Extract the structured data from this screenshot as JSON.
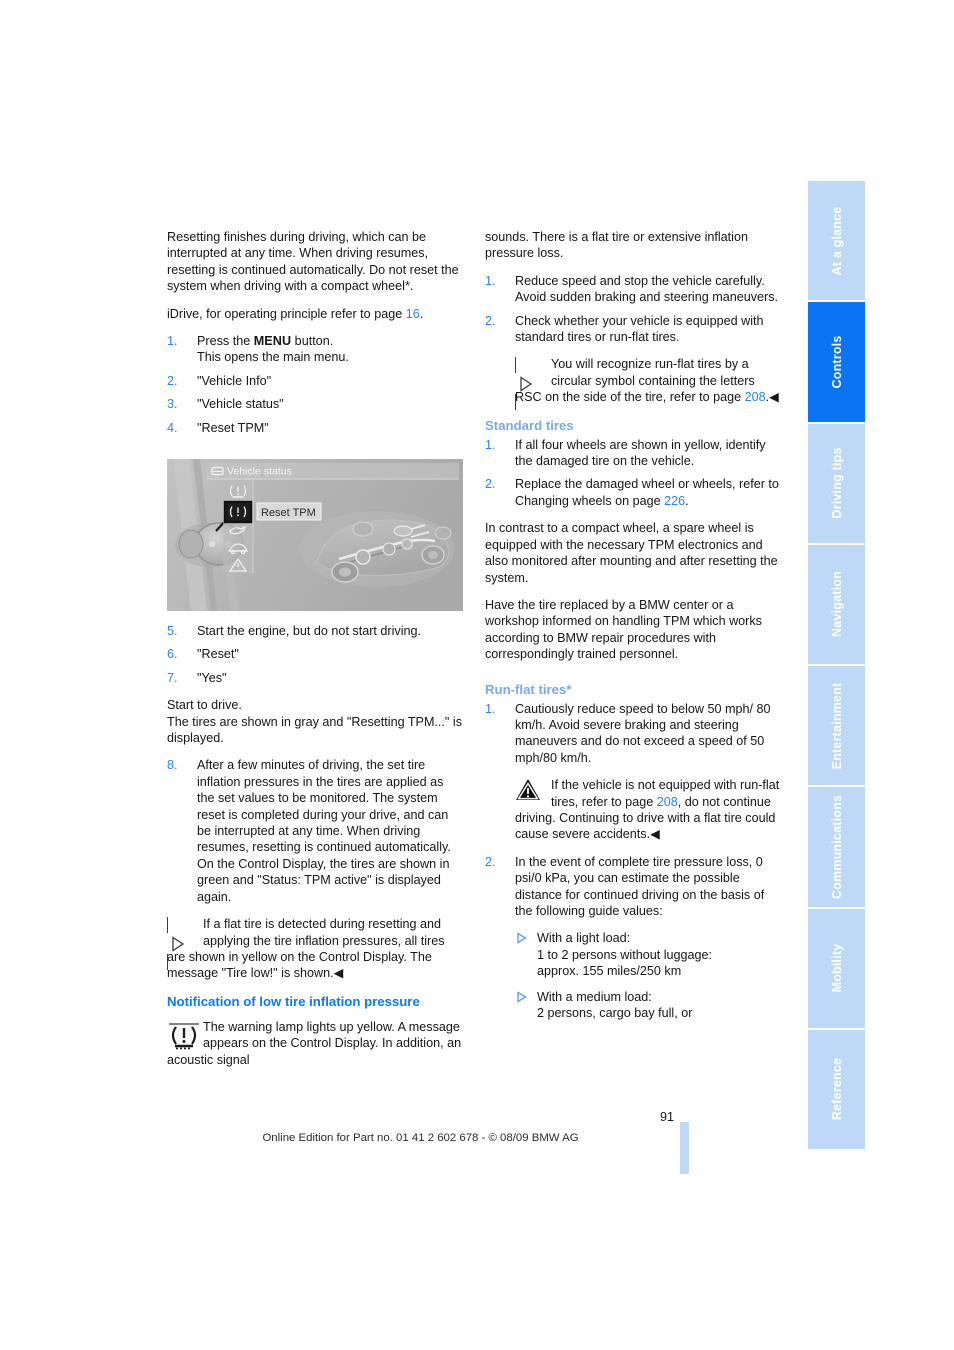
{
  "page": {
    "number": "91",
    "footer_note": "Online Edition for Part no. 01 41 2 602 678 - © 08/09 BMW AG"
  },
  "tabs": [
    {
      "label": "At a glance",
      "active": false
    },
    {
      "label": "Controls",
      "active": true
    },
    {
      "label": "Driving tips",
      "active": false
    },
    {
      "label": "Navigation",
      "active": false
    },
    {
      "label": "Entertainment",
      "active": false
    },
    {
      "label": "Communications",
      "active": false
    },
    {
      "label": "Mobility",
      "active": false
    },
    {
      "label": "Reference",
      "active": false
    }
  ],
  "colors": {
    "tab_active": "#0a74f5",
    "tab_inactive": "#bdd9f7",
    "heading_blue": "#0d7bf0",
    "subheading_blue": "#7ba9e9",
    "link_blue": "#2b83f2"
  },
  "left_column": {
    "intro_paragraph": "Resetting finishes during driving, which can be interrupted at any time. When driving resumes, resetting is continued automatically. Do not reset the system when driving with a compact wheel*.",
    "idrive_line_pre": "iDrive, for operating principle refer to page ",
    "idrive_page_ref": "16",
    "idrive_line_post": ".",
    "steps_1_4": [
      {
        "num": "1.",
        "text_pre": "Press the ",
        "bold": "MENU",
        "text_post": " button.",
        "second_line": "This opens the main menu."
      },
      {
        "num": "2.",
        "text": "\"Vehicle Info\""
      },
      {
        "num": "3.",
        "text": "\"Vehicle status\""
      },
      {
        "num": "4.",
        "text": "\"Reset TPM\""
      }
    ],
    "figure": {
      "name": "idrive-vehicle-status-screen",
      "header_label": "Vehicle status",
      "menu_item_label": "Reset TPM",
      "side_icons": [
        "tpm-status-icon",
        "reset-tpm-icon",
        "oil-can-icon",
        "car-icon",
        "warning-triangle-icon"
      ]
    },
    "steps_5_8": [
      {
        "num": "5.",
        "text": "Start the engine, but do not start driving."
      },
      {
        "num": "6.",
        "text": "\"Reset\""
      },
      {
        "num": "7.",
        "text": "\"Yes\""
      }
    ],
    "start_to_drive": "Start to drive.\nThe tires are shown in gray and \"Resetting TPM...\" is displayed.",
    "start_to_drive_line1": "Start to drive.",
    "start_to_drive_line2": "The tires are shown in gray and \"Resetting TPM...\" is displayed.",
    "step_8": {
      "num": "8.",
      "text": "After a few minutes of driving, the set tire inflation pressures in the tires are applied as the set values to be monitored. The system reset is completed during your drive, and can be interrupted at any time. When driving resumes, resetting is continued automatically. On the Control Display, the tires are shown in green and \"Status: TPM active\" is displayed again."
    },
    "note_flat_tire": "If a flat tire is detected during resetting and applying the tire inflation pressures, all tires are shown in yellow on the Control Display. The message \"Tire low!\" is shown.",
    "heading_notification": "Notification of low tire inflation pressure",
    "warning_lamp_text": "The warning lamp lights up yellow. A message appears on the Control Display. In addition, an acoustic signal"
  },
  "right_column": {
    "continuation": "sounds. There is a flat tire or extensive inflation pressure loss.",
    "steps_top": [
      {
        "num": "1.",
        "text": "Reduce speed and stop the vehicle carefully. Avoid sudden braking and steering maneuvers."
      },
      {
        "num": "2.",
        "text": "Check whether your vehicle is equipped with standard tires or run-flat tires."
      }
    ],
    "note_rsc_pre": "You will recognize run-flat tires by a circular symbol containing the letters RSC on the side of the tire, refer to page ",
    "note_rsc_page": "208",
    "note_rsc_post": ".",
    "heading_standard_tires": "Standard tires",
    "standard_steps": [
      {
        "num": "1.",
        "text": "If all four wheels are shown in yellow, identify the damaged tire on the vehicle."
      },
      {
        "num": "2.",
        "text_pre": "Replace the damaged wheel or wheels, refer to Changing wheels on page ",
        "page_ref": "226",
        "text_post": "."
      }
    ],
    "spare_wheel_paragraph": "In contrast to a compact wheel, a spare wheel is equipped with the necessary TPM electronics and also monitored after mounting and after resetting the system.",
    "bmw_center_paragraph": "Have the tire replaced by a BMW center or a workshop informed on handling TPM which works according to BMW repair procedures with correspondingly trained personnel.",
    "heading_run_flat": "Run-flat tires*",
    "run_flat_step_1": {
      "num": "1.",
      "text": "Cautiously reduce speed to below 50 mph/ 80 km/h. Avoid severe braking and steering maneuvers and do not exceed a speed of 50 mph/80 km/h."
    },
    "warning_pre": "If the vehicle is not equipped with run-flat tires, refer to page ",
    "warning_page": "208",
    "warning_post": ", do not continue driving. Continuing to drive with a flat tire could cause severe accidents.",
    "run_flat_step_2": {
      "num": "2.",
      "text": "In the event of complete tire pressure loss, 0 psi/0 kPa, you can estimate the possible distance for continued driving on the basis of the following guide values:"
    },
    "guide_values": [
      {
        "line1": "With a light load:",
        "line2": "1 to 2 persons without luggage:",
        "line3": "approx. 155 miles/250 km"
      },
      {
        "line1": "With a medium load:",
        "line2": "2 persons, cargo bay full, or",
        "line3": ""
      }
    ]
  }
}
